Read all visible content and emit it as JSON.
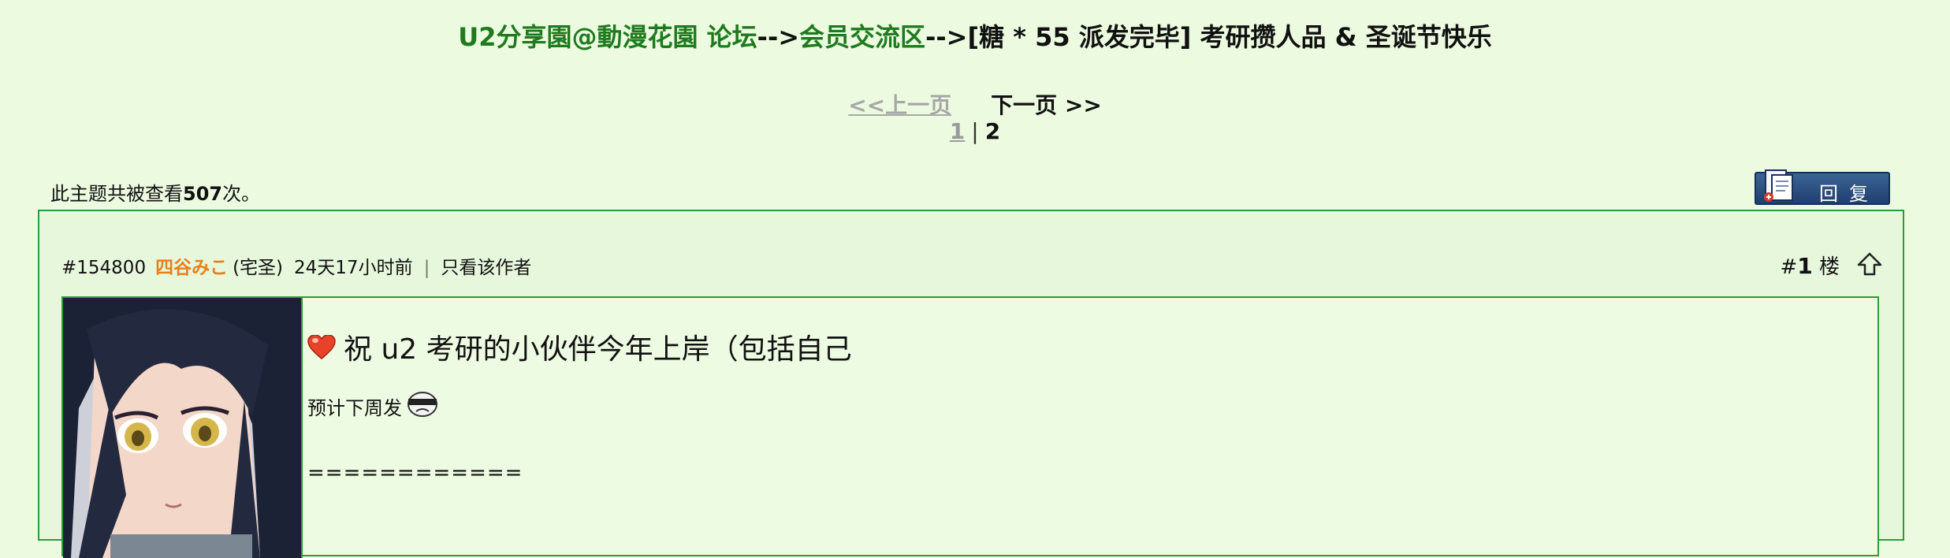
{
  "breadcrumb": {
    "forum": "U2分享園@動漫花園 论坛",
    "sep1": "-->",
    "section": "会员交流区",
    "sep2": "-->",
    "thread": "[糖 * 55 派发完毕] 考研攒人品 & 圣诞节快乐"
  },
  "pager": {
    "prev": "<<上一页",
    "next": "下一页 >>",
    "page1": "1",
    "separator": "|",
    "page2": "2"
  },
  "views": {
    "prefix": "此主题共被查看",
    "count": "507",
    "suffix": "次。"
  },
  "reply_button": {
    "label": "回复",
    "icon": "reply-document-icon"
  },
  "post": {
    "id": "#154800",
    "author": "四谷みこ",
    "author_title": "(宅圣)",
    "time": "24天17小时前",
    "divider": "|",
    "only_author": "只看该作者",
    "floor_prefix": "#",
    "floor_number": "1",
    "floor_suffix": "楼",
    "title_text": "祝 u2 考研的小伙伴今年上岸（包括自己",
    "line2": "预计下周发",
    "line3": "============",
    "colors": {
      "author": "#e8801a",
      "link": "#1f7a1f",
      "border": "#2f9a3a",
      "background": "#ecfbe0"
    }
  }
}
